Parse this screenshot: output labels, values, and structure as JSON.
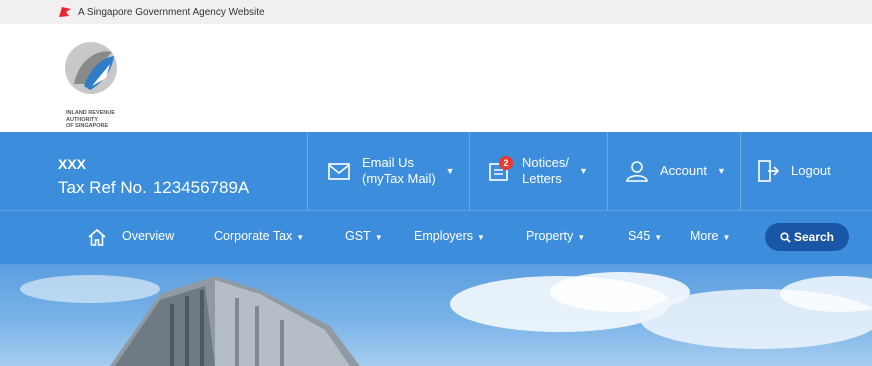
{
  "gov_bar": {
    "text": "A Singapore Government Agency Website"
  },
  "logo": {
    "lines": [
      "INLAND REVENUE",
      "AUTHORITY",
      "OF SINGAPORE"
    ]
  },
  "account": {
    "name": "XXX",
    "tax_ref_label": "Tax Ref No.",
    "tax_ref_number": "123456789A"
  },
  "utility_menu": {
    "email_line1": "Email Us",
    "email_line2": "(myTax Mail)",
    "notices_line1": "Notices/",
    "notices_line2": "Letters",
    "notices_badge": "2",
    "account_label": "Account",
    "logout_label": "Logout"
  },
  "nav": {
    "overview": "Overview",
    "corporate_tax": "Corporate Tax",
    "gst": "GST",
    "employers": "Employers",
    "property": "Property",
    "s45": "S45",
    "more": "More",
    "search": "Search"
  },
  "icons": {
    "flag": "red-flag-icon",
    "email": "envelope-icon",
    "notices": "document-icon",
    "account": "user-icon",
    "logout": "door-exit-icon",
    "home": "home-icon",
    "search": "magnifier-icon",
    "caret": "caret-down-icon"
  },
  "colors": {
    "primary": "#3c8ddb",
    "search_button": "#1a56a6",
    "badge": "#e63b2e",
    "flag": "#e8262f"
  }
}
